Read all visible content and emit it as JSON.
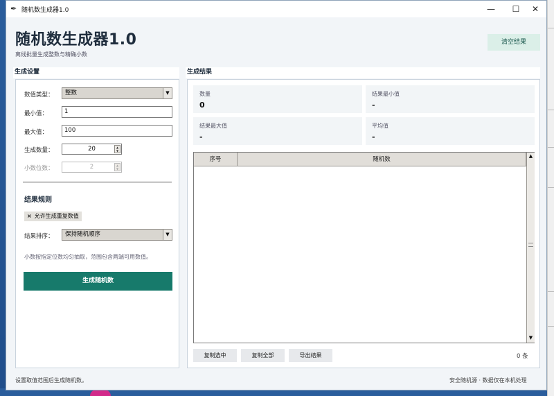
{
  "window": {
    "title": "随机数生成器1.0",
    "min": "—",
    "max": "☐",
    "close": "✕",
    "icon": "feather-icon"
  },
  "header": {
    "title": "随机数生成器1.0",
    "subtitle": "离线批量生成整数与精确小数",
    "clear_label": "清空结果"
  },
  "settings": {
    "heading": "生成设置",
    "type_label": "数值类型：",
    "type_value": "整数",
    "min_label": "最小值：",
    "min_value": "1",
    "max_label": "最大值：",
    "max_value": "100",
    "count_label": "生成数量：",
    "count_value": "20",
    "decimals_label": "小数位数：",
    "decimals_value": "2",
    "rules_heading": "结果规则",
    "allow_dup_label": "允许生成重复数值",
    "allow_dup_checked": true,
    "check_mark": "×",
    "sort_label": "结果排序：",
    "sort_value": "保持随机顺序",
    "hint": "小数按指定位数均匀抽取，范围包含两端可用数值。",
    "generate_label": "生成随机数"
  },
  "results": {
    "heading": "生成结果",
    "stats": [
      {
        "label": "数量",
        "value": "0"
      },
      {
        "label": "结果最小值",
        "value": "-"
      },
      {
        "label": "结果最大值",
        "value": "-"
      },
      {
        "label": "平均值",
        "value": "-"
      }
    ],
    "columns": [
      "序号",
      "随机数"
    ],
    "rows": [],
    "copy_selected": "复制选中",
    "copy_all": "复制全部",
    "export": "导出结果",
    "count_text": "0 条"
  },
  "status": {
    "left": "设置取值范围后生成随机数。",
    "right": "安全随机源 · 数据仅在本机处理"
  },
  "colors": {
    "accent": "#177a6b",
    "clear_bg": "#dbefe8",
    "panel_bg": "#f2f5f8"
  }
}
